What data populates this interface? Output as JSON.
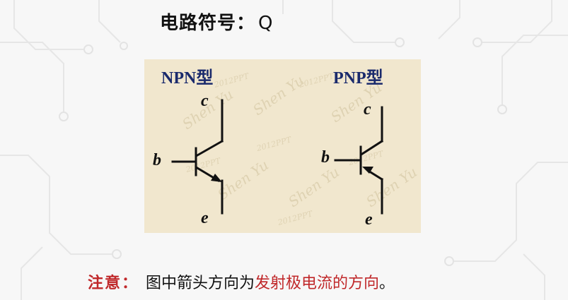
{
  "title": {
    "label": "电路符号：",
    "value": "Q"
  },
  "diagram": {
    "npn": {
      "heading": "NPN型",
      "c": "c",
      "b": "b",
      "e": "e"
    },
    "pnp": {
      "heading": "PNP型",
      "c": "c",
      "b": "b",
      "e": "e"
    },
    "watermark_name": "Shen Yu",
    "watermark_year": "2012PPT"
  },
  "note": {
    "prefix": "注意：",
    "plain": "图中箭头方向为",
    "emph": "发射极电流的方向",
    "end": "。"
  },
  "colors": {
    "panel_bg": "#f1e7ce",
    "accent_red": "#c0282a",
    "heading_blue": "#1a2a6c"
  }
}
